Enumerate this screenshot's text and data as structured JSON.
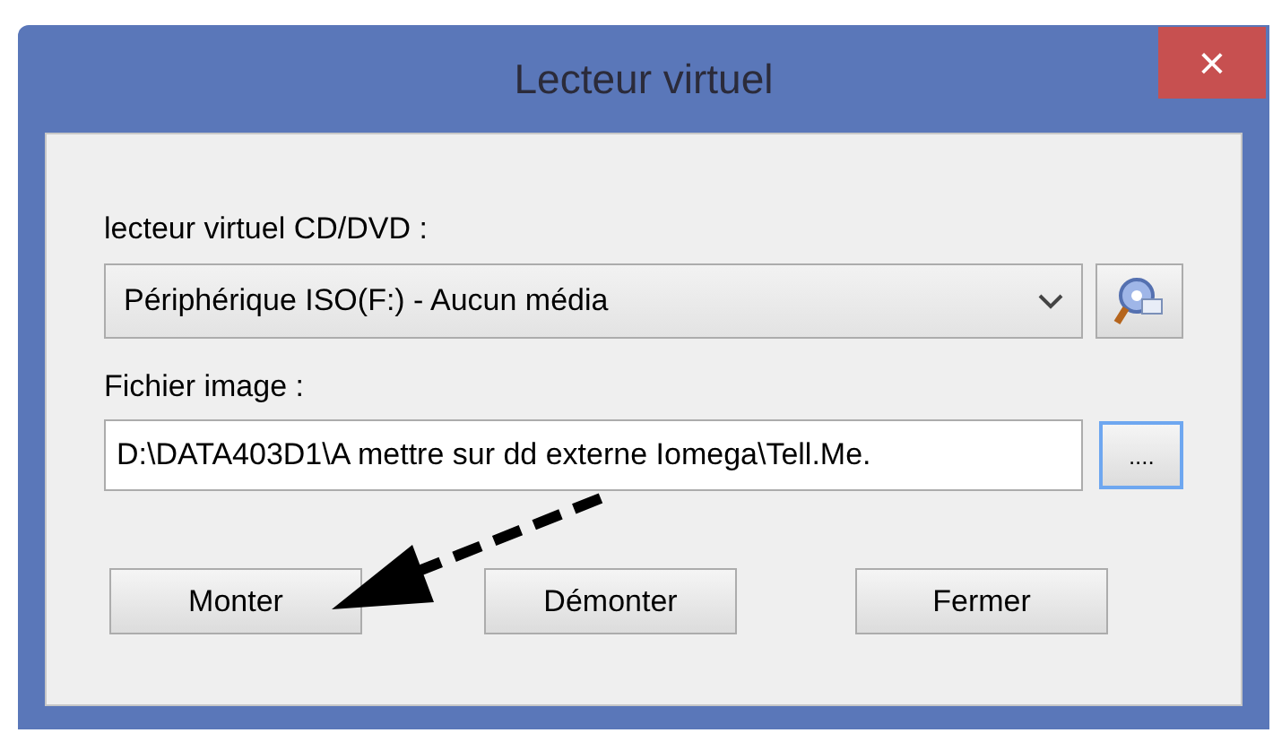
{
  "window": {
    "title": "Lecteur virtuel",
    "close": "×"
  },
  "drive": {
    "label": "lecteur virtuel CD/DVD :",
    "value": "Périphérique ISO(F:) - Aucun média"
  },
  "image_file": {
    "label": "Fichier image :",
    "value": "D:\\DATA403D1\\A mettre sur dd externe Iomega\\Tell.Me.",
    "browse": "...."
  },
  "buttons": [
    "Monter",
    "Démonter",
    "Fermer"
  ]
}
